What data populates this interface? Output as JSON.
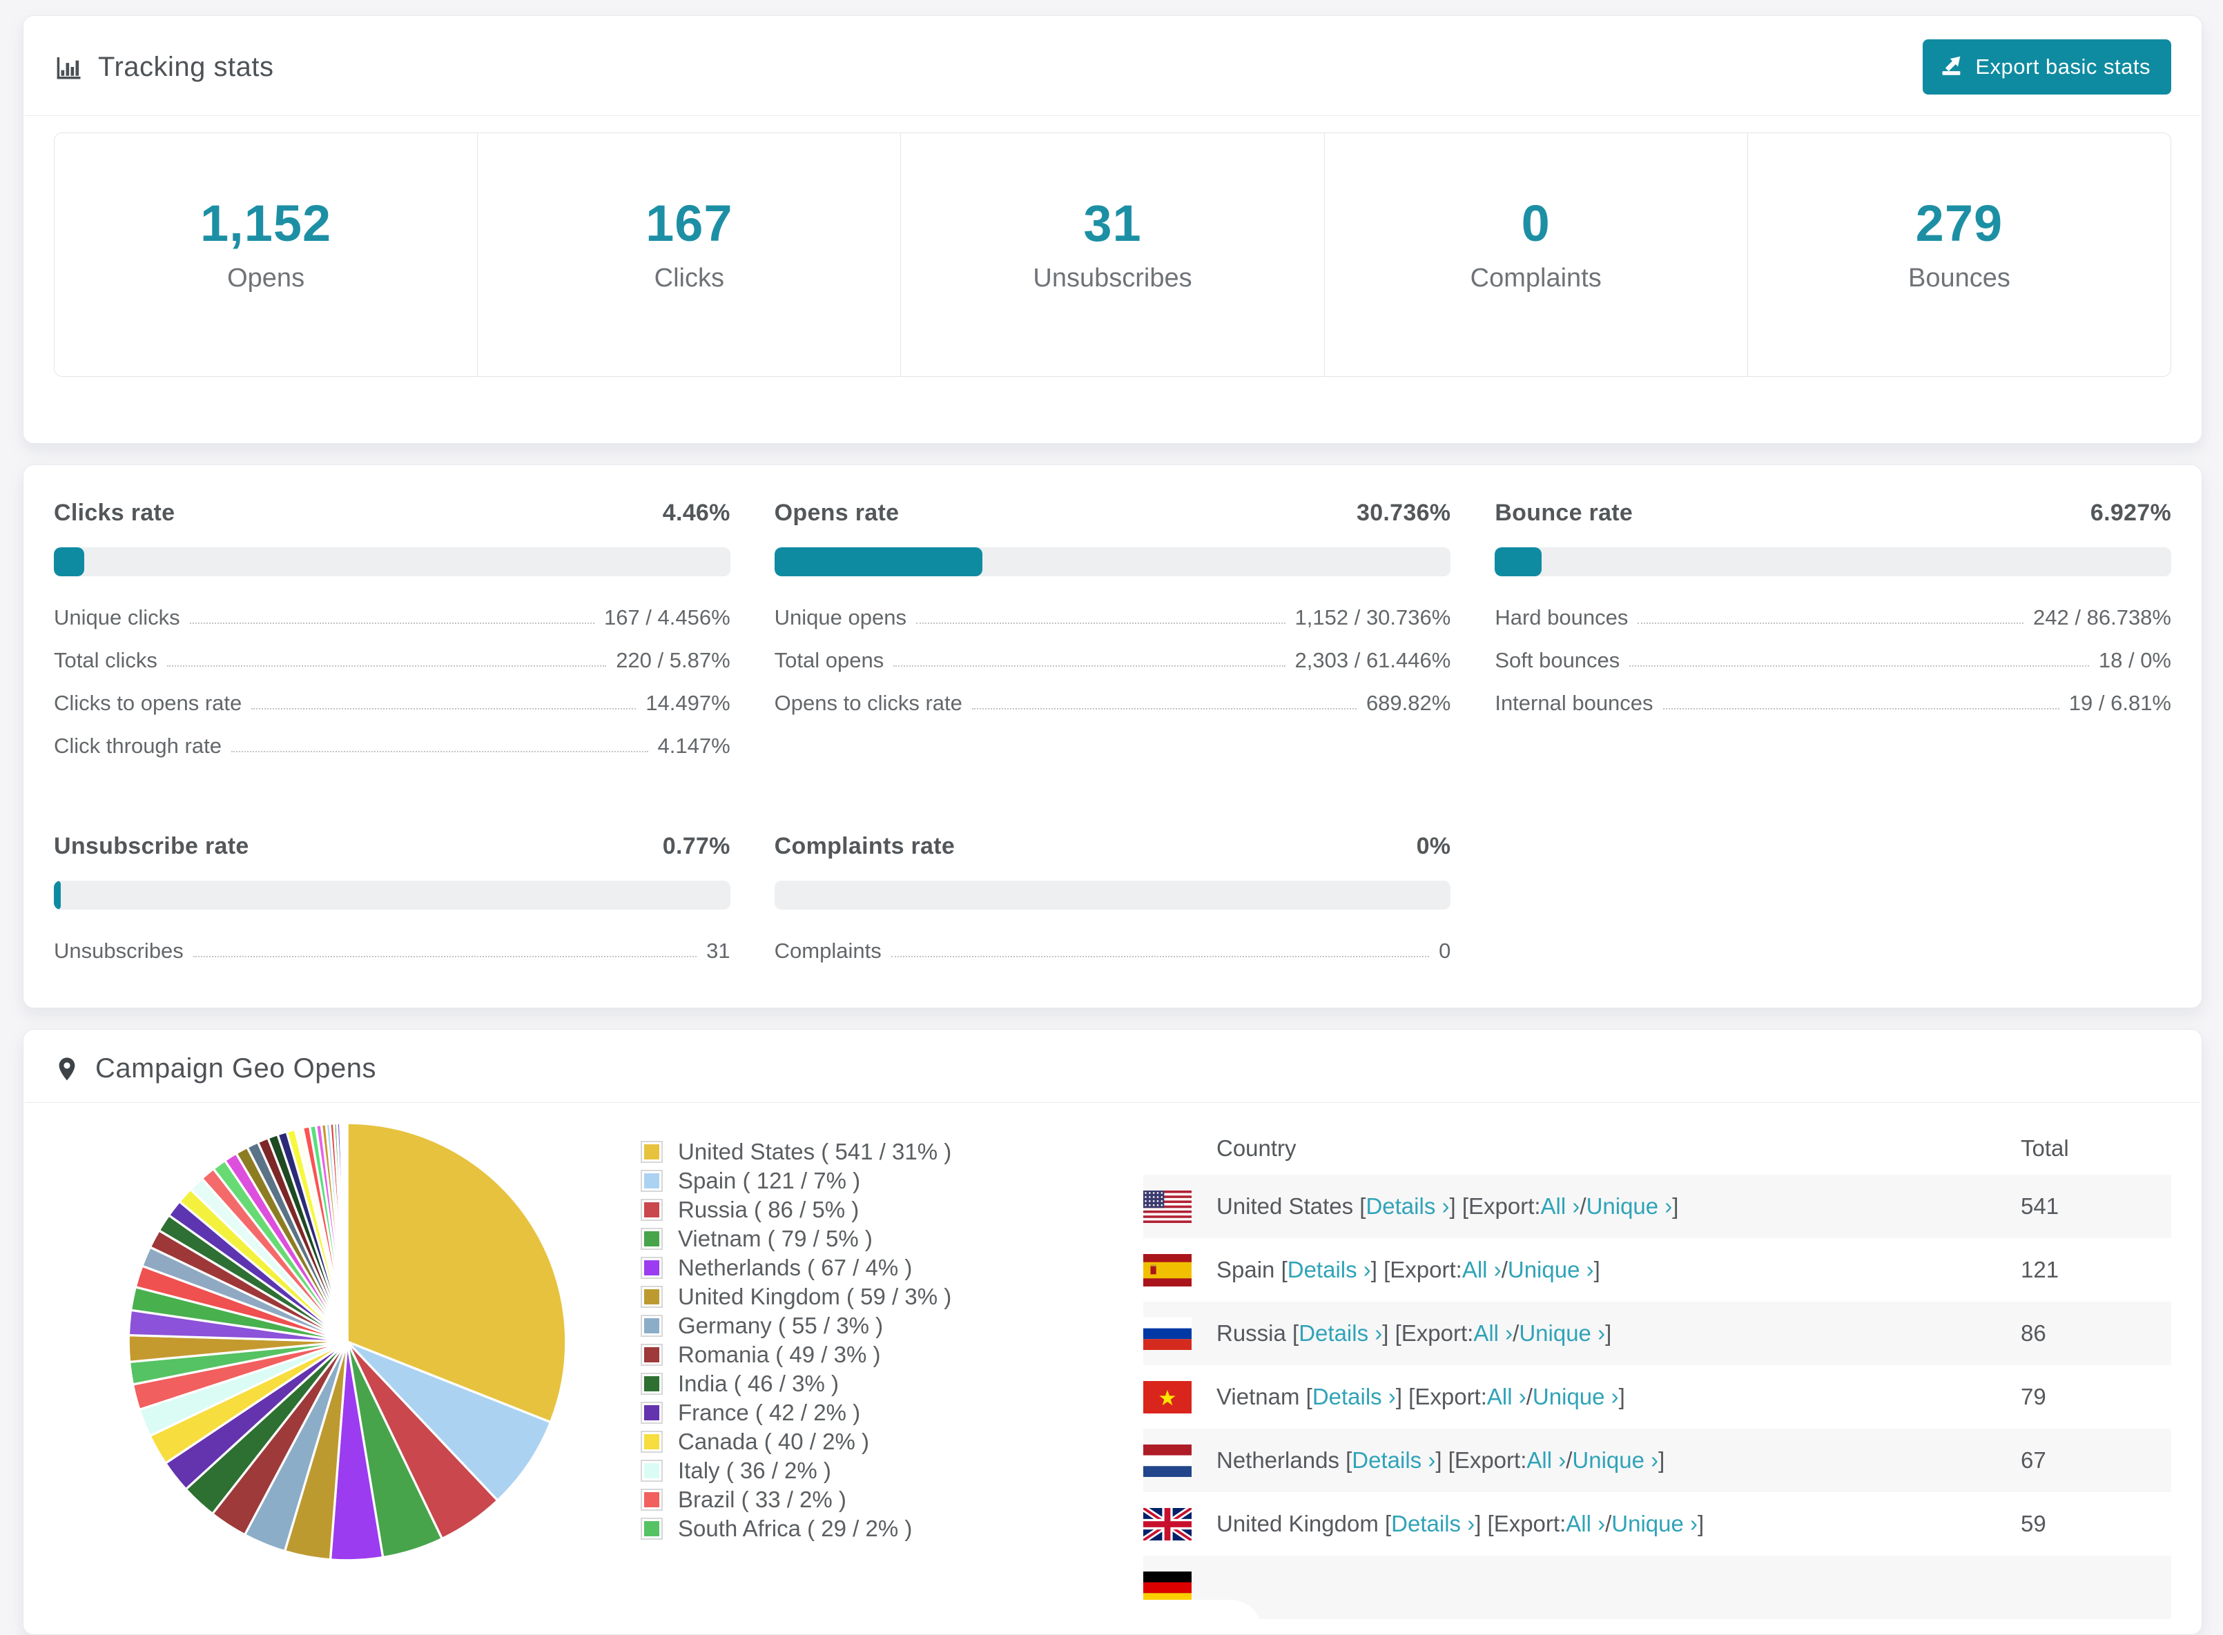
{
  "accent_color": "#0f8ba1",
  "link_color": "#2fa3b8",
  "tracking": {
    "title": "Tracking stats",
    "export_button": "Export basic stats",
    "stats": [
      {
        "value": "1,152",
        "label": "Opens"
      },
      {
        "value": "167",
        "label": "Clicks"
      },
      {
        "value": "31",
        "label": "Unsubscribes"
      },
      {
        "value": "0",
        "label": "Complaints"
      },
      {
        "value": "279",
        "label": "Bounces"
      }
    ]
  },
  "rates": [
    {
      "id": "clicks",
      "title": "Clicks rate",
      "value": "4.46%",
      "percent": 4.46,
      "rows": [
        [
          "Unique clicks",
          "167 / 4.456%"
        ],
        [
          "Total clicks",
          "220 / 5.87%"
        ],
        [
          "Clicks to opens rate",
          "14.497%"
        ],
        [
          "Click through rate",
          "4.147%"
        ]
      ]
    },
    {
      "id": "opens",
      "title": "Opens rate",
      "value": "30.736%",
      "percent": 30.736,
      "rows": [
        [
          "Unique opens",
          "1,152 / 30.736%"
        ],
        [
          "Total opens",
          "2,303 / 61.446%"
        ],
        [
          "Opens to clicks rate",
          "689.82%"
        ]
      ]
    },
    {
      "id": "bounce",
      "title": "Bounce rate",
      "value": "6.927%",
      "percent": 6.927,
      "rows": [
        [
          "Hard bounces",
          "242 / 86.738%"
        ],
        [
          "Soft bounces",
          "18 / 0%"
        ],
        [
          "Internal bounces",
          "19 / 6.81%"
        ]
      ]
    },
    {
      "id": "unsubscribe",
      "title": "Unsubscribe rate",
      "value": "0.77%",
      "percent": 0.77,
      "rows": [
        [
          "Unsubscribes",
          "31"
        ]
      ]
    },
    {
      "id": "complaints",
      "title": "Complaints rate",
      "value": "0%",
      "percent": 0,
      "rows": [
        [
          "Complaints",
          "0"
        ]
      ]
    }
  ],
  "geo": {
    "title": "Campaign Geo Opens",
    "table": {
      "columns": [
        "Country",
        "Total"
      ],
      "links": {
        "details": "Details ›",
        "export_label": "Export:",
        "all": "All ›",
        "unique": "Unique ›"
      },
      "rows": [
        {
          "flag": "us",
          "country": "United States",
          "total": "541"
        },
        {
          "flag": "es",
          "country": "Spain",
          "total": "121"
        },
        {
          "flag": "ru",
          "country": "Russia",
          "total": "86"
        },
        {
          "flag": "vn",
          "country": "Vietnam",
          "total": "79"
        },
        {
          "flag": "nl",
          "country": "Netherlands",
          "total": "67"
        },
        {
          "flag": "gb",
          "country": "United Kingdom",
          "total": "59"
        },
        {
          "flag": "de",
          "country": "",
          "total": ""
        }
      ]
    }
  },
  "chart_data": {
    "type": "pie",
    "title": "Campaign Geo Opens",
    "legend_position": "right",
    "start_angle_deg": -90,
    "direction": "clockwise",
    "series": [
      {
        "name": "United States",
        "value": 541,
        "percent": "31%",
        "color": "#e7c23f"
      },
      {
        "name": "Spain",
        "value": 121,
        "percent": "7%",
        "color": "#acd2f2"
      },
      {
        "name": "Russia",
        "value": 86,
        "percent": "5%",
        "color": "#c9474d"
      },
      {
        "name": "Vietnam",
        "value": 79,
        "percent": "5%",
        "color": "#47a44b"
      },
      {
        "name": "Netherlands",
        "value": 67,
        "percent": "4%",
        "color": "#9b3cf0"
      },
      {
        "name": "United Kingdom",
        "value": 59,
        "percent": "3%",
        "color": "#bd9a30"
      },
      {
        "name": "Germany",
        "value": 55,
        "percent": "3%",
        "color": "#8cadc8"
      },
      {
        "name": "Romania",
        "value": 49,
        "percent": "3%",
        "color": "#9e3a3a"
      },
      {
        "name": "India",
        "value": 46,
        "percent": "3%",
        "color": "#2d7032"
      },
      {
        "name": "France",
        "value": 42,
        "percent": "2%",
        "color": "#6433ae"
      },
      {
        "name": "Canada",
        "value": 40,
        "percent": "2%",
        "color": "#f7dd3e"
      },
      {
        "name": "Italy",
        "value": 36,
        "percent": "2%",
        "color": "#dbfcf5"
      },
      {
        "name": "Brazil",
        "value": 33,
        "percent": "2%",
        "color": "#f15f5f"
      },
      {
        "name": "South Africa",
        "value": 29,
        "percent": "2%",
        "color": "#55c263"
      }
    ],
    "others_unlabeled": {
      "values": [
        34,
        32,
        30,
        28,
        26,
        24,
        23,
        22,
        21,
        20,
        19,
        18,
        17,
        16,
        15,
        14,
        13,
        12,
        11,
        10,
        9,
        8,
        7,
        6,
        5,
        5,
        4,
        4,
        3,
        1,
        1,
        1,
        1,
        1,
        1
      ],
      "colors": [
        "#c49a2f",
        "#8c52d9",
        "#49b04e",
        "#ef5050",
        "#8fa9c2",
        "#9e3838",
        "#2e6f33",
        "#5d35b0",
        "#f4f13e",
        "#e6fcf6",
        "#f46a6a",
        "#68da74",
        "#dd4fdd",
        "#8d7d22",
        "#5b7386",
        "#7e2727",
        "#1d4a21",
        "#2c2a78",
        "#f7f73c",
        "#fffdf2",
        "#fb5252",
        "#57e07e",
        "#e860e8",
        "#c8962b",
        "#a6d2f2",
        "#e23d3d",
        "#43ae55",
        "#7c3fd1",
        "#b8b8e8",
        "#d4a017",
        "#6666cc",
        "#cc6666",
        "#66cc66",
        "#cccccc",
        "#ee88ee"
      ]
    }
  }
}
